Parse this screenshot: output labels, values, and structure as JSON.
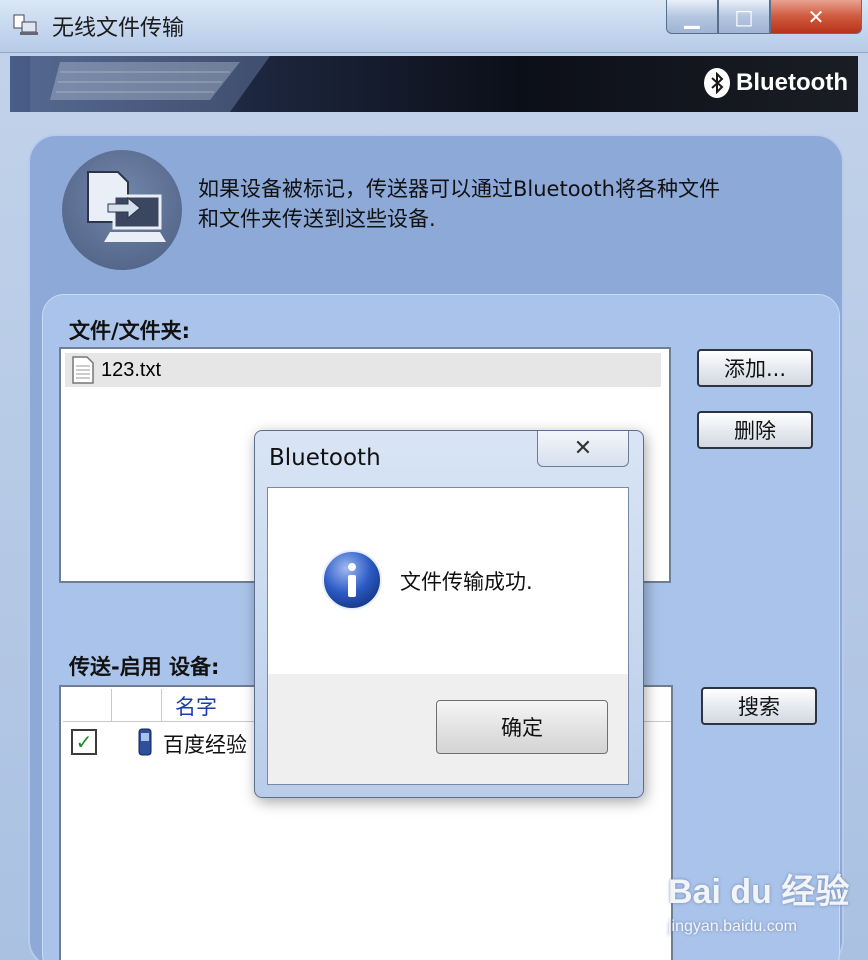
{
  "window": {
    "title": "无线文件传输",
    "brand": "Bluetooth",
    "controls": {
      "minimize": "▁",
      "maximize": "□",
      "close": "✕"
    }
  },
  "info": {
    "description_line1": "如果设备被标记，传送器可以通过Bluetooth将各种文件",
    "description_line2": "和文件夹传送到这些设备."
  },
  "files": {
    "label": "文件/文件夹:",
    "items": [
      {
        "name": "123.txt"
      }
    ],
    "add_button": "添加...",
    "delete_button": "删除"
  },
  "devices": {
    "label": "传送-启用 设备:",
    "column_name": "名字",
    "items": [
      {
        "checked": true,
        "name": "百度经验"
      }
    ],
    "search_button": "搜索"
  },
  "dialog": {
    "title": "Bluetooth",
    "close": "✕",
    "message": "文件传输成功.",
    "ok_button": "确定"
  },
  "watermark": {
    "logo": "Bai du 经验",
    "url": "jingyan.baidu.com"
  },
  "colors": {
    "panel": "#8da9d8",
    "subpanel": "#aac3ea",
    "close_button": "#cf5a3e",
    "checkmark": "#1c8a2a"
  }
}
